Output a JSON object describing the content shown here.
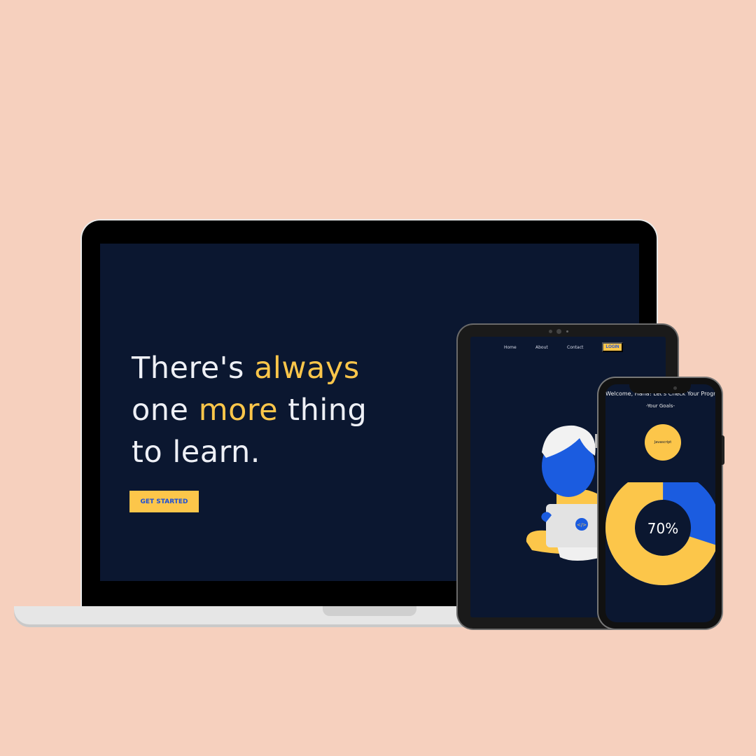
{
  "laptop": {
    "headline": {
      "part1": "There's ",
      "accent1": "always",
      "part2": "one ",
      "accent2": "more",
      "part3": " thing",
      "part4": "to learn."
    },
    "cta_label": "GET STARTED"
  },
  "tablet": {
    "nav": {
      "home": "Home",
      "about": "About",
      "contact": "Contact",
      "login": "LOGIN"
    },
    "laptop_icon_code": "</>"
  },
  "phone": {
    "welcome": "Welcome, Hana! Let's Check Your Progress",
    "goals_title": "-Your Goals-",
    "goal_name": "Javascript",
    "progress_label": "70%",
    "progress_fraction": 0.7
  },
  "colors": {
    "background": "#f6d0be",
    "screen": "#0b1730",
    "accent_yellow": "#fcc64a",
    "accent_blue": "#1b5ce0"
  }
}
